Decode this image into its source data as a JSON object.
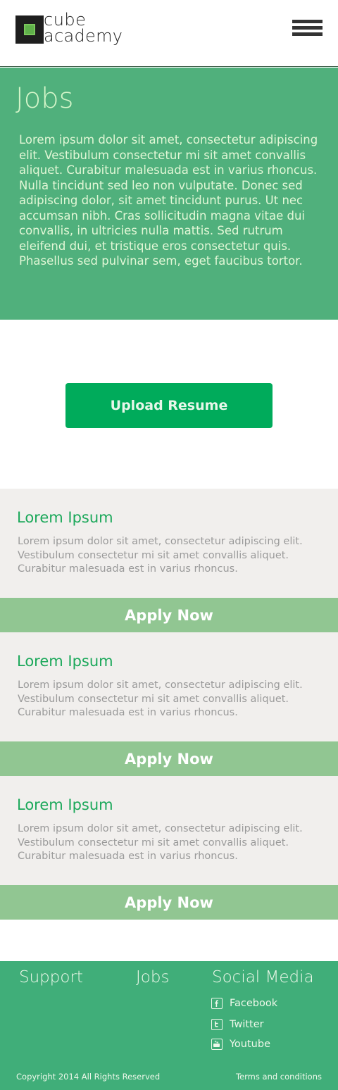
{
  "header": {
    "logo_line1": "cube",
    "logo_line2": "academy"
  },
  "hero": {
    "title": "Jobs",
    "text": "Lorem ipsum dolor sit amet, consectetur adipiscing elit. Vestibulum consectetur mi sit amet convallis aliquet. Curabitur malesuada est in varius rhoncus. Nulla tincidunt sed leo non vulputate. Donec sed adipiscing dolor, sit amet tincidunt purus. Ut nec accumsan nibh. Cras sollicitudin magna vitae dui convallis, in ultricies nulla mattis. Sed rutrum eleifend dui, et tristique eros consectetur quis. Phasellus sed pulvinar sem, eget faucibus tortor."
  },
  "upload_label": "Upload Resume",
  "jobs": [
    {
      "title": "Lorem Ipsum",
      "description": "Lorem ipsum dolor sit amet, consectetur adipiscing elit. Vestibulum consectetur mi sit amet convallis aliquet. Curabitur malesuada est in varius rhoncus.",
      "apply_label": "Apply Now"
    },
    {
      "title": "Lorem Ipsum",
      "description": "Lorem ipsum dolor sit amet, consectetur adipiscing elit. Vestibulum consectetur mi sit amet convallis aliquet. Curabitur malesuada est in varius rhoncus.",
      "apply_label": "Apply Now"
    },
    {
      "title": "Lorem Ipsum",
      "description": "Lorem ipsum dolor sit amet, consectetur adipiscing elit. Vestibulum consectetur mi sit amet convallis aliquet. Curabitur malesuada est in varius rhoncus.",
      "apply_label": "Apply Now"
    }
  ],
  "footer": {
    "support": "Support",
    "jobs": "Jobs",
    "social_title": "Social Media",
    "social": [
      {
        "label": "Facebook",
        "icon": "facebook-icon"
      },
      {
        "label": "Twitter",
        "icon": "twitter-icon"
      },
      {
        "label": "Youtube",
        "icon": "youtube-icon"
      }
    ],
    "copyright": "Copyright 2014 All Rights Reserved",
    "terms": "Terms and conditions"
  },
  "colors": {
    "hero_bg": "#50b07c",
    "upload_bg": "#00ab5b",
    "apply_bg": "#91c692",
    "card_bg": "#f1efed",
    "footer_bg": "#40ae79",
    "job_title": "#1ba85a"
  }
}
